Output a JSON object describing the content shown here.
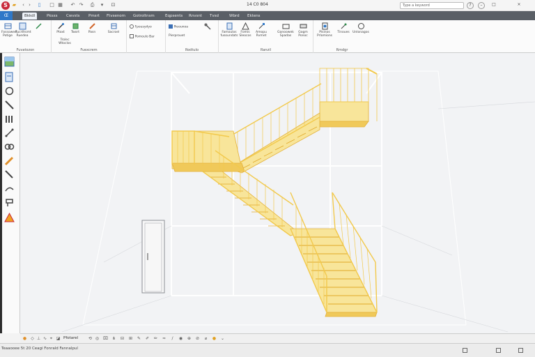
{
  "titlebar": {
    "app_logo": "S",
    "title": "14 C0 804",
    "search_placeholder": "Type a keyword",
    "window_controls": [
      "?",
      "–",
      "□",
      "×"
    ]
  },
  "tabs": {
    "file": "Œ",
    "items": [
      "Bkkdl",
      "Pksxs",
      "Cwvsts",
      "Pmsrt",
      "Ftvsenom",
      "Gotroltnsm",
      "Eqpsents",
      "Rnvsnt",
      "Tvsd",
      "Wbrd",
      "Ektens"
    ],
    "active_index": 0
  },
  "ribbon": {
    "groups": [
      {
        "label": "Fuvatozon",
        "tools": [
          "Fossowert\nPotige",
          "Fucrthsmt\nRuedea"
        ]
      },
      {
        "label": "Fuexcrem",
        "tools": [
          "Ptoxt",
          "Twort",
          "Pasn",
          "Sacroel",
          "Trolec\nWtoclos"
        ]
      },
      {
        "label": "",
        "tools": [
          "Fpousydyo",
          "Pomoulo Bar"
        ]
      },
      {
        "label": "Rodtulo",
        "tools": [
          "Pieounoa",
          "Pierprouet"
        ]
      },
      {
        "label": "Ranzil",
        "tools": [
          "Famoulos\nfusoundats",
          "Fomis\nSleocos",
          "Amopu\nRvmet",
          "Ganoowek\nSpadas",
          "Gogm\nPonoc"
        ]
      },
      {
        "label": "Rmdgr",
        "tools": [
          "Pisinos\nPrlomions",
          "Tinoues",
          "Unlonagos"
        ]
      }
    ]
  },
  "statusbar": {
    "text": "Teaaooee 5t 20 Ceagi Fonrald Fannalpul"
  },
  "viewbar": {
    "scale_label": "Pfotarel"
  },
  "colors": {
    "stair": "#f2c94c",
    "stair_dark": "#e0a928",
    "frame": "#ffffff",
    "tab_bar": "#5a5f66",
    "logo": "#c8283a"
  },
  "left_tools": [
    "image-icon",
    "document-icon",
    "rotate-icon",
    "brush-icon",
    "bars-icon",
    "measure-icon",
    "chain-icon",
    "pencil-icon",
    "paint-icon",
    "wand-icon",
    "stamp-icon",
    "warning-icon"
  ]
}
